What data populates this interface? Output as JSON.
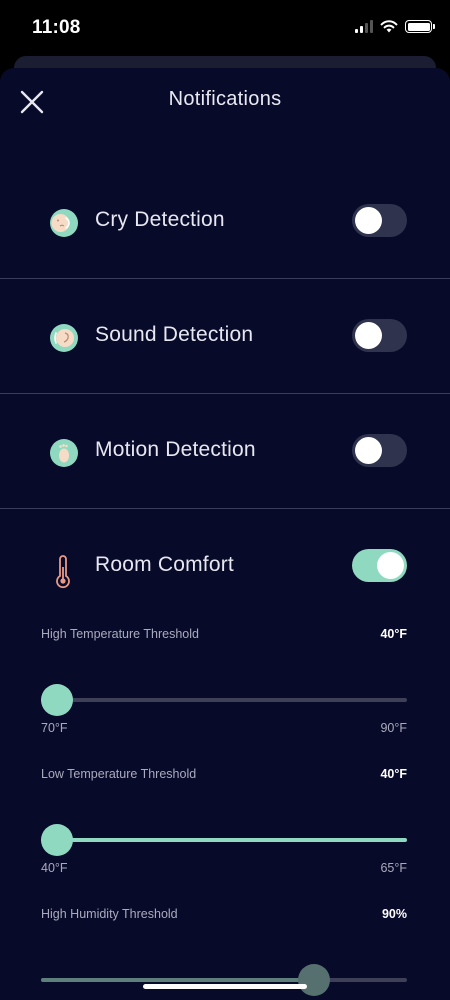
{
  "status_bar": {
    "time": "11:08"
  },
  "header": {
    "title": "Notifications"
  },
  "rows": [
    {
      "label": "Cry Detection",
      "icon": "cry-face-icon",
      "enabled": false
    },
    {
      "label": "Sound Detection",
      "icon": "ear-sound-icon",
      "enabled": false
    },
    {
      "label": "Motion Detection",
      "icon": "footprint-icon",
      "enabled": false
    },
    {
      "label": "Room Comfort",
      "icon": "thermometer-icon",
      "enabled": true
    }
  ],
  "thresholds": [
    {
      "label": "High Temperature Threshold",
      "value": "40°F",
      "min_label": "70°F",
      "max_label": "90°F",
      "level": 0.0
    },
    {
      "label": "Low Temperature Threshold",
      "value": "40°F",
      "min_label": "40°F",
      "max_label": "65°F",
      "level": 0.0
    },
    {
      "label": "High Humidity Threshold",
      "value": "90%",
      "level": 0.77
    }
  ],
  "colors": {
    "background": "#080a29",
    "accent": "#8fd9c0",
    "thermometer": "#e89a86"
  }
}
